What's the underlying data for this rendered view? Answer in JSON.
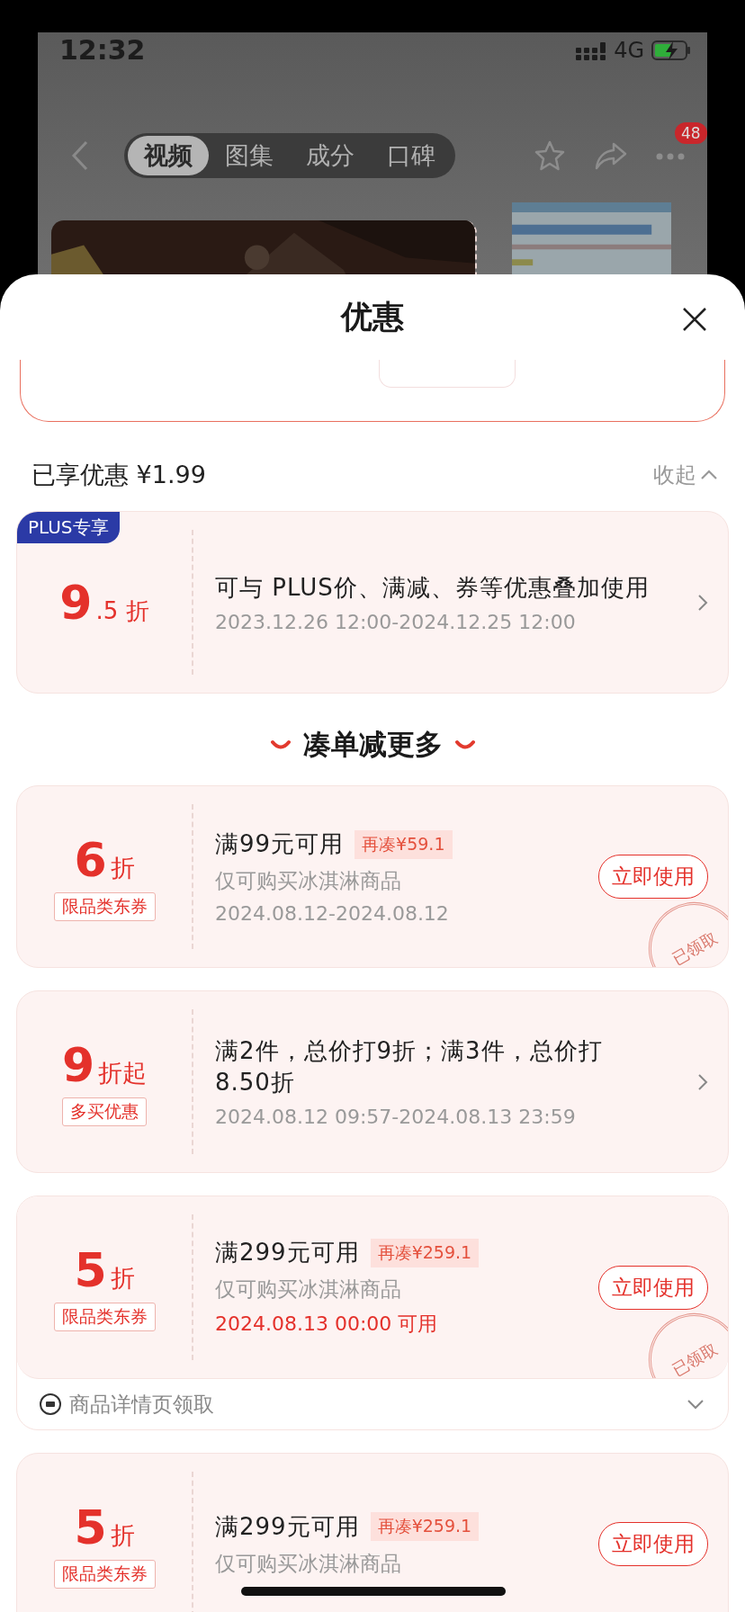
{
  "status_bar": {
    "time": "12:32",
    "network": "4G"
  },
  "nav": {
    "tabs": [
      {
        "label": "视频",
        "selected": true
      },
      {
        "label": "图集",
        "selected": false
      },
      {
        "label": "成分",
        "selected": false
      },
      {
        "label": "口碑",
        "selected": false
      }
    ],
    "badge": "48"
  },
  "sheet": {
    "title": "优惠",
    "summary": "已享优惠 ¥1.99",
    "collapse": "收起"
  },
  "plus_offer": {
    "badge": "PLUS专享",
    "value": "9",
    "unit": ".5 折",
    "title": "可与 PLUS价、满减、券等优惠叠加使用",
    "date": "2023.12.26 12:00-2024.12.25 12:00"
  },
  "section_title": "凑单减更多",
  "coupons": [
    {
      "value": "6",
      "unit": "折",
      "tag": "限品类东券",
      "title": "满99元可用",
      "gap": "再凑¥59.1",
      "scope": "仅可购买冰淇淋商品",
      "date": "2024.08.12-2024.08.12",
      "date_highlight": false,
      "action": {
        "kind": "button",
        "label": "立即使用"
      },
      "stamp": "已领取"
    },
    {
      "value": "9",
      "unit": "折起",
      "tag": "多买优惠",
      "title": "满2件，总价打9折；满3件，总价打8.50折",
      "date": "2024.08.12 09:57-2024.08.13 23:59",
      "date_highlight": false,
      "action": {
        "kind": "chevron"
      }
    },
    {
      "value": "5",
      "unit": "折",
      "tag": "限品类东券",
      "title": "满299元可用",
      "gap": "再凑¥259.1",
      "scope": "仅可购买冰淇淋商品",
      "date": "2024.08.13 00:00 可用",
      "date_highlight": true,
      "action": {
        "kind": "button",
        "label": "立即使用"
      },
      "stamp": "已领取",
      "footer": "商品详情页领取"
    },
    {
      "value": "5",
      "unit": "折",
      "tag": "限品类东券",
      "title": "满299元可用",
      "gap": "再凑¥259.1",
      "scope": "仅可购买冰淇淋商品",
      "action": {
        "kind": "button",
        "label": "立即使用"
      }
    }
  ]
}
